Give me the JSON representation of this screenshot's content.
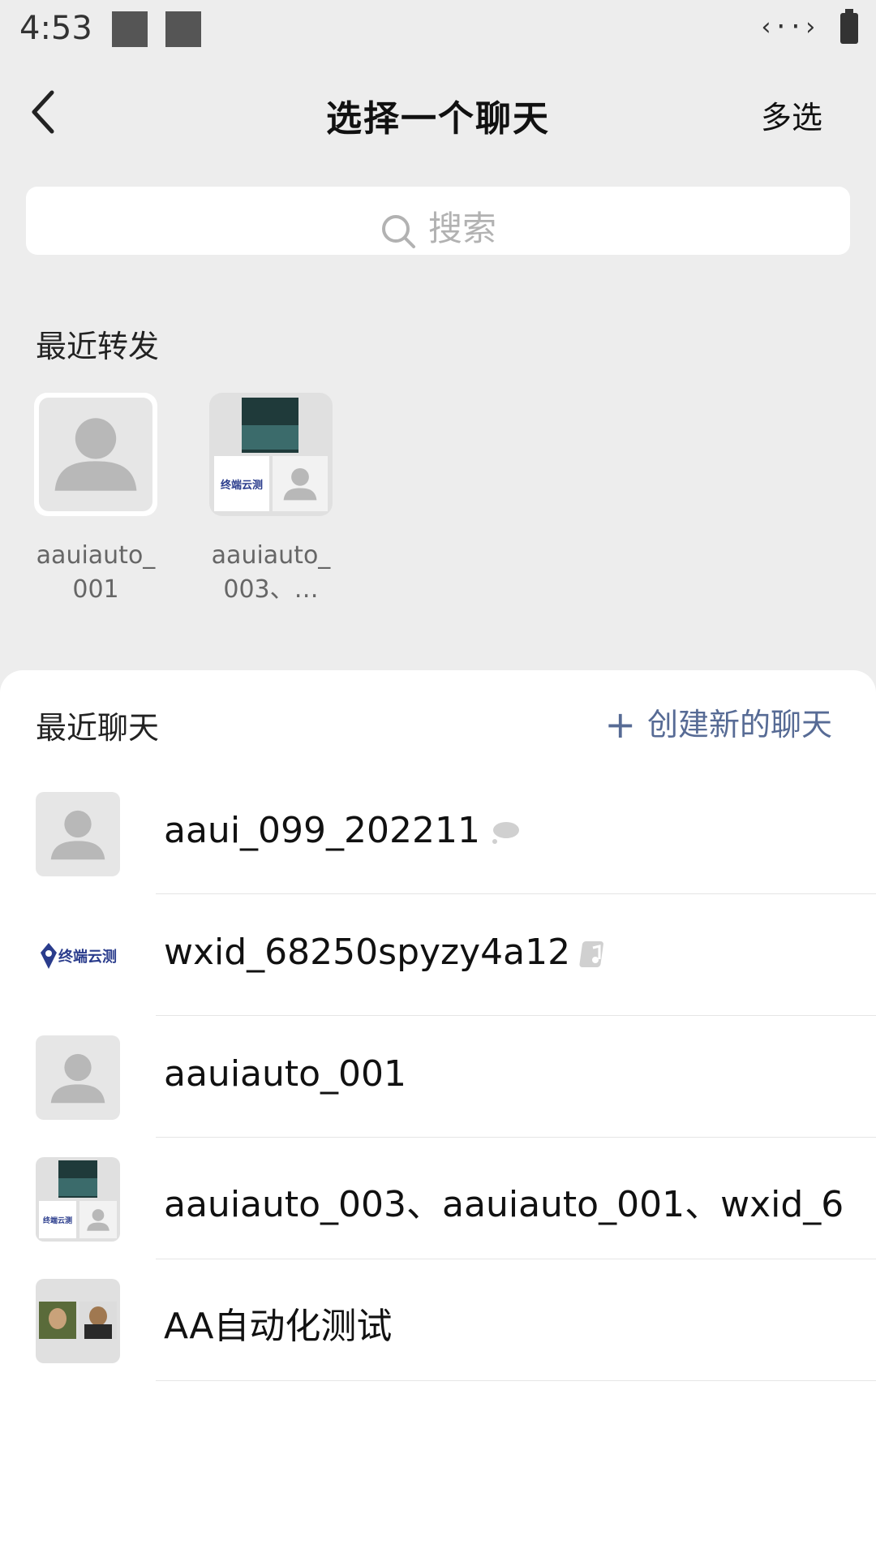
{
  "status_bar": {
    "time": "4:53",
    "network": "‹··›"
  },
  "header": {
    "title": "选择一个聊天",
    "multi_select": "多选"
  },
  "search": {
    "placeholder": "搜索"
  },
  "recent_forwards": {
    "label": "最近转发",
    "items": [
      {
        "name": "aauiauto_001"
      },
      {
        "name": "aauiauto_003、…"
      }
    ]
  },
  "recent_chats": {
    "label": "最近聊天",
    "create_label": "创建新的聊天",
    "items": [
      {
        "name": "aaui_099_202211",
        "badge": "cloud-icon"
      },
      {
        "name": "wxid_68250spyzy4a12",
        "badge": "music-icon"
      },
      {
        "name": "aauiauto_001"
      },
      {
        "name": "aauiauto_003、aauiauto_001、wxid_6…"
      },
      {
        "name": "AA自动化测试"
      }
    ]
  },
  "logo_text": "终端云测",
  "colors": {
    "background": "#ededed",
    "link": "#576b95",
    "placeholder": "#b2b2b2"
  }
}
